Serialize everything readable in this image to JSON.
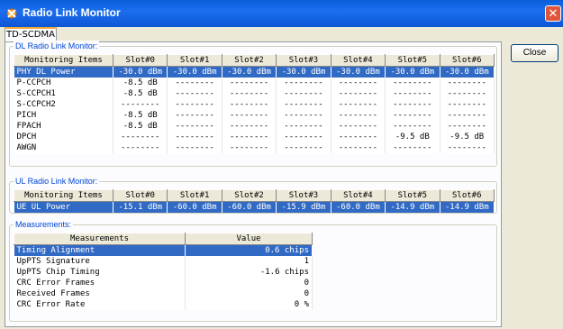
{
  "window": {
    "title": "Radio Link Monitor",
    "close_glyph": "✕"
  },
  "tab": {
    "label": "TD-SCDMA"
  },
  "close_button": {
    "label": "Close"
  },
  "dl": {
    "label": "DL Radio Link Monitor:",
    "headers": [
      "Monitoring Items",
      "Slot#0",
      "Slot#1",
      "Slot#2",
      "Slot#3",
      "Slot#4",
      "Slot#5",
      "Slot#6"
    ],
    "rows": [
      [
        "PHY DL Power",
        "-30.0 dBm",
        "-30.0 dBm",
        "-30.0 dBm",
        "-30.0 dBm",
        "-30.0 dBm",
        "-30.0 dBm",
        "-30.0 dBm"
      ],
      [
        "P-CCPCH",
        "-8.5 dB",
        "--------",
        "--------",
        "--------",
        "--------",
        "--------",
        "--------"
      ],
      [
        "S-CCPCH1",
        "-8.5 dB",
        "--------",
        "--------",
        "--------",
        "--------",
        "--------",
        "--------"
      ],
      [
        "S-CCPCH2",
        "--------",
        "--------",
        "--------",
        "--------",
        "--------",
        "--------",
        "--------"
      ],
      [
        "PICH",
        "-8.5 dB",
        "--------",
        "--------",
        "--------",
        "--------",
        "--------",
        "--------"
      ],
      [
        "FPACH",
        "-8.5 dB",
        "--------",
        "--------",
        "--------",
        "--------",
        "--------",
        "--------"
      ],
      [
        "DPCH",
        "--------",
        "--------",
        "--------",
        "--------",
        "--------",
        "-9.5 dB",
        "-9.5 dB"
      ],
      [
        "AWGN",
        "--------",
        "--------",
        "--------",
        "--------",
        "--------",
        "--------",
        "--------"
      ]
    ]
  },
  "ul": {
    "label": "UL Radio Link Monitor:",
    "headers": [
      "Monitoring Items",
      "Slot#0",
      "Slot#1",
      "Slot#2",
      "Slot#3",
      "Slot#4",
      "Slot#5",
      "Slot#6"
    ],
    "rows": [
      [
        "UE UL Power",
        "-15.1 dBm",
        "-60.0 dBm",
        "-60.0 dBm",
        "-15.9 dBm",
        "-60.0 dBm",
        "-14.9 dBm",
        "-14.9 dBm"
      ]
    ]
  },
  "meas": {
    "label": "Measurements:",
    "headers": [
      "Measurements",
      "Value"
    ],
    "rows": [
      [
        "Timing Alignment",
        "0.6 chips"
      ],
      [
        "UpPTS Signature",
        "1"
      ],
      [
        "UpPTS Chip Timing",
        "-1.6 chips"
      ],
      [
        "CRC Error Frames",
        "0"
      ],
      [
        "Received Frames",
        "0"
      ],
      [
        "CRC Error Rate",
        "0 %"
      ]
    ]
  },
  "colors": {
    "selection": "#316ac5",
    "group_label": "#0046d5",
    "titlebar": "#0a5fd8"
  },
  "icons": {
    "app": "radio-link-icon",
    "close": "close-icon"
  }
}
